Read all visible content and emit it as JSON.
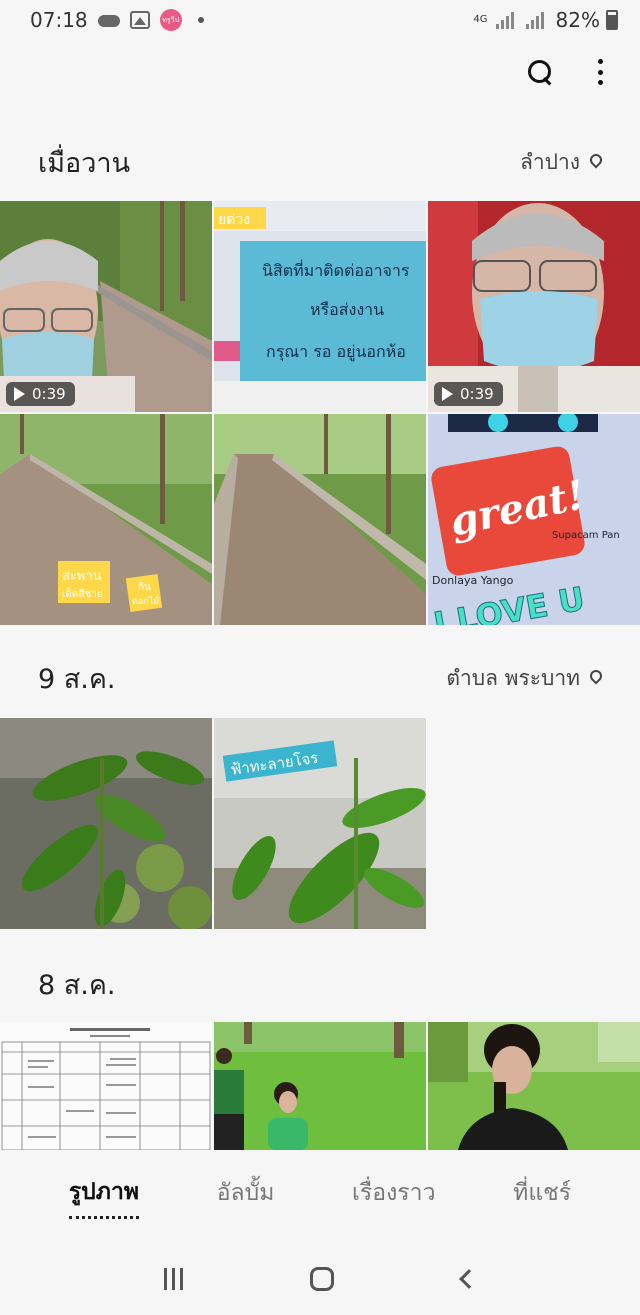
{
  "status": {
    "time": "07:18",
    "app_badge": "ทรูวีป",
    "network": "4G",
    "battery": "82%",
    "battery_level": 0.82
  },
  "sections": [
    {
      "title": "เมื่อวาน",
      "location": "ลำปาง"
    },
    {
      "title": "9 ส.ค.",
      "location": "ตำบล พระบาท"
    },
    {
      "title": "8 ส.ค."
    }
  ],
  "photos": {
    "p1": {
      "duration": "0:39"
    },
    "p2": {
      "tag": "ยด่วง",
      "sign_lines": [
        "นิสิตที่มาติดต่ออาจาร",
        "หรือส่งงาน",
        "กรุณา รอ อยู่นอกห้อ"
      ]
    },
    "p3": {
      "duration": "0:39"
    },
    "p4": {
      "tags": [
        "สะพาน",
        "เด็ดสีชาย",
        "กิน",
        "ดอกไม้"
      ]
    },
    "p6": {
      "great": "great!",
      "love": "I LOVE U",
      "name1": "Donlaya Yango",
      "name2": "Supacam Pan"
    },
    "p8": {
      "tag": "ฟ้าทะลายโจร"
    }
  },
  "tabs": [
    "รูปภาพ",
    "อัลบั้ม",
    "เรื่องราว",
    "ที่แชร์"
  ],
  "active_tab": "รูปภาพ"
}
